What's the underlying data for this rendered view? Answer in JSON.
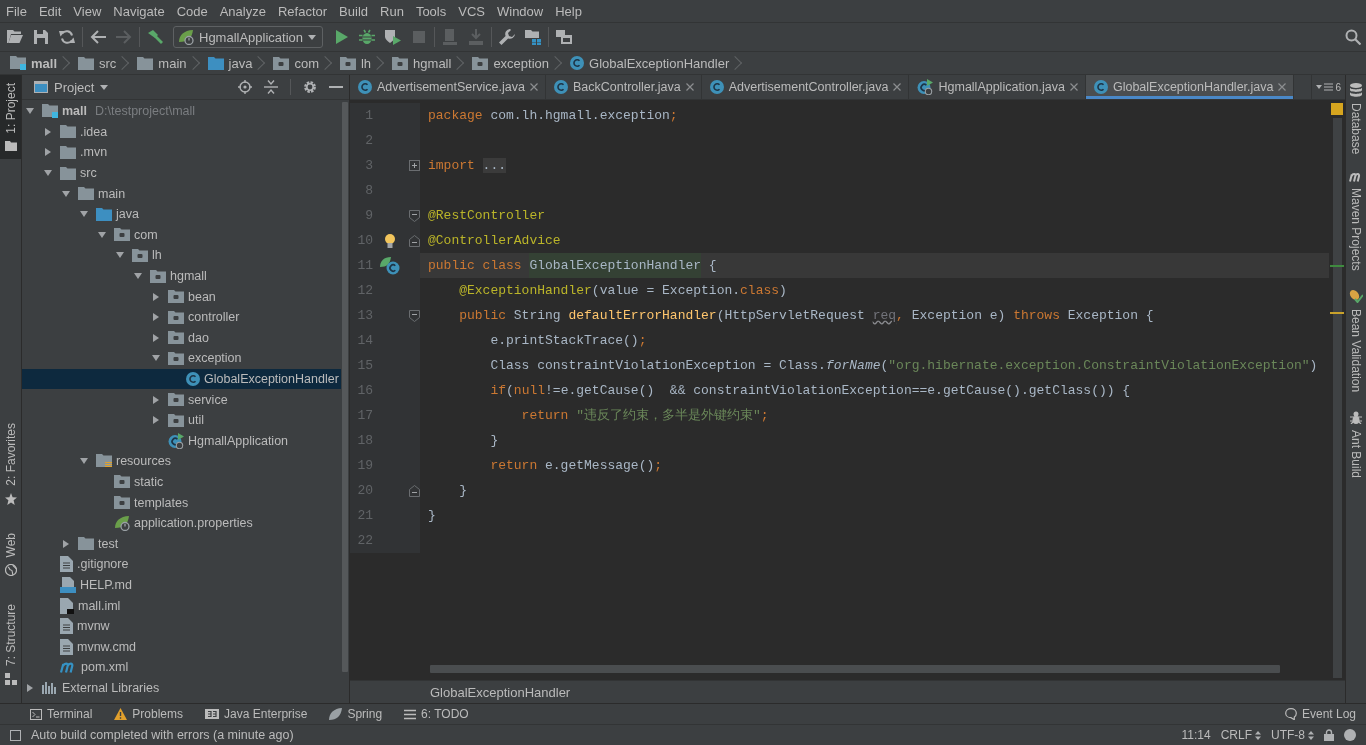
{
  "menu_bar": {
    "items": [
      "File",
      "Edit",
      "View",
      "Navigate",
      "Code",
      "Analyze",
      "Refactor",
      "Build",
      "Run",
      "Tools",
      "VCS",
      "Window",
      "Help"
    ]
  },
  "toolbar": {
    "groups": [
      {
        "items": [
          {
            "kind": "open",
            "disabled": false
          },
          {
            "kind": "save",
            "disabled": false
          },
          {
            "kind": "sync",
            "disabled": false
          }
        ]
      },
      {
        "items": [
          {
            "kind": "back",
            "disabled": false
          },
          {
            "kind": "forward",
            "disabled": true
          }
        ]
      },
      {
        "items": [
          {
            "kind": "build",
            "disabled": false
          },
          {
            "kind": "run_config",
            "label": "HgmallApplication",
            "disabled": false
          },
          {
            "kind": "run",
            "disabled": false
          },
          {
            "kind": "debug",
            "disabled": false
          },
          {
            "kind": "coverage",
            "disabled": false
          },
          {
            "kind": "stop",
            "disabled": true
          }
        ]
      },
      {
        "items": [
          {
            "kind": "device",
            "disabled": true
          },
          {
            "kind": "deploy",
            "disabled": true
          }
        ]
      },
      {
        "items": [
          {
            "kind": "settings",
            "disabled": false
          },
          {
            "kind": "project_structure",
            "disabled": false
          }
        ]
      },
      {
        "items": [
          {
            "kind": "windows",
            "disabled": false
          }
        ]
      }
    ]
  },
  "breadcrumbs": [
    {
      "label": "mall",
      "kind": "module"
    },
    {
      "label": "src",
      "kind": "folder"
    },
    {
      "label": "main",
      "kind": "folder"
    },
    {
      "label": "java",
      "kind": "source_folder"
    },
    {
      "label": "com",
      "kind": "package"
    },
    {
      "label": "lh",
      "kind": "package"
    },
    {
      "label": "hgmall",
      "kind": "package"
    },
    {
      "label": "exception",
      "kind": "package"
    },
    {
      "label": "GlobalExceptionHandler",
      "kind": "class"
    }
  ],
  "left_stripe": {
    "top": [
      {
        "label": "1: Project",
        "kind": "project",
        "selected": true
      }
    ],
    "bottom": [
      {
        "label": "2: Favorites",
        "kind": "favorites",
        "selected": false
      },
      {
        "label": "Web",
        "kind": "web",
        "selected": false
      },
      {
        "label": "7: Structure",
        "kind": "structure",
        "selected": false
      }
    ]
  },
  "project_panel": {
    "title": "Project",
    "tree": [
      {
        "label": "mall",
        "path": "D:\\testproject\\mall",
        "kind": "module",
        "expanded": true,
        "selected": false,
        "children": [
          {
            "label": ".idea",
            "kind": "folder",
            "expanded": false,
            "selected": false
          },
          {
            "label": ".mvn",
            "kind": "folder",
            "expanded": false,
            "selected": false
          },
          {
            "label": "src",
            "kind": "folder",
            "expanded": true,
            "selected": false,
            "children": [
              {
                "label": "main",
                "kind": "folder",
                "expanded": true,
                "selected": false,
                "children": [
                  {
                    "label": "java",
                    "kind": "source_folder",
                    "expanded": true,
                    "selected": false,
                    "children": [
                      {
                        "label": "com",
                        "kind": "package",
                        "expanded": true,
                        "selected": false,
                        "children": [
                          {
                            "label": "lh",
                            "kind": "package",
                            "expanded": true,
                            "selected": false,
                            "children": [
                              {
                                "label": "hgmall",
                                "kind": "package",
                                "expanded": true,
                                "selected": false,
                                "children": [
                                  {
                                    "label": "bean",
                                    "kind": "package",
                                    "expanded": false,
                                    "selected": false
                                  },
                                  {
                                    "label": "controller",
                                    "kind": "package",
                                    "expanded": false,
                                    "selected": false
                                  },
                                  {
                                    "label": "dao",
                                    "kind": "package",
                                    "expanded": false,
                                    "selected": false
                                  },
                                  {
                                    "label": "exception",
                                    "kind": "package",
                                    "expanded": true,
                                    "selected": false,
                                    "children": [
                                      {
                                        "label": "GlobalExceptionHandler",
                                        "kind": "class",
                                        "selected": true
                                      }
                                    ]
                                  },
                                  {
                                    "label": "service",
                                    "kind": "package",
                                    "expanded": false,
                                    "selected": false
                                  },
                                  {
                                    "label": "util",
                                    "kind": "package",
                                    "expanded": false,
                                    "selected": false
                                  },
                                  {
                                    "label": "HgmallApplication",
                                    "kind": "spring_class",
                                    "selected": false
                                  }
                                ]
                              }
                            ]
                          }
                        ]
                      }
                    ]
                  },
                  {
                    "label": "resources",
                    "kind": "resources",
                    "expanded": true,
                    "selected": false,
                    "children": [
                      {
                        "label": "static",
                        "kind": "package",
                        "selected": false
                      },
                      {
                        "label": "templates",
                        "kind": "package",
                        "selected": false
                      },
                      {
                        "label": "application.properties",
                        "kind": "spring_config",
                        "selected": false
                      }
                    ]
                  }
                ]
              },
              {
                "label": "test",
                "kind": "folder",
                "expanded": false,
                "selected": false
              }
            ]
          },
          {
            "label": ".gitignore",
            "kind": "file",
            "selected": false
          },
          {
            "label": "HELP.md",
            "kind": "markdown",
            "selected": false
          },
          {
            "label": "mall.iml",
            "kind": "module_file",
            "selected": false
          },
          {
            "label": "mvnw",
            "kind": "file",
            "selected": false
          },
          {
            "label": "mvnw.cmd",
            "kind": "file",
            "selected": false
          },
          {
            "label": "pom.xml",
            "kind": "maven",
            "selected": false
          }
        ]
      },
      {
        "label": "External Libraries",
        "kind": "libraries",
        "expanded": false,
        "selected": false
      }
    ]
  },
  "editor": {
    "tabs": [
      {
        "label": "AdvertisementService.java",
        "kind": "class",
        "selected": false
      },
      {
        "label": "BackController.java",
        "kind": "class",
        "selected": false
      },
      {
        "label": "AdvertisementController.java",
        "kind": "class",
        "selected": false
      },
      {
        "label": "HgmallApplication.java",
        "kind": "spring_class",
        "selected": false
      },
      {
        "label": "GlobalExceptionHandler.java",
        "kind": "class",
        "selected": true
      }
    ],
    "tab_overflow_count": "6",
    "lines": [
      {
        "number": "1",
        "current": false,
        "tokens": [
          {
            "text": "package",
            "kind": "keyword"
          },
          {
            "text": " com.lh.hgmall.exception",
            "kind": "plain"
          },
          {
            "text": ";",
            "kind": "keyword"
          }
        ]
      },
      {
        "number": "2",
        "current": false
      },
      {
        "number": "3",
        "current": false,
        "fold": {
          "kind": "collapsed"
        },
        "tokens": [
          {
            "text": "import ",
            "kind": "keyword"
          },
          {
            "text": "...",
            "kind": "folded"
          }
        ]
      },
      {
        "number": "8",
        "current": false
      },
      {
        "number": "9",
        "current": false,
        "fold": {
          "kind": "start"
        },
        "tokens": [
          {
            "text": "@RestController",
            "kind": "annotation"
          }
        ]
      },
      {
        "number": "10",
        "current": false,
        "fold": {
          "kind": "end"
        },
        "marker": {
          "kind": "intention"
        },
        "tokens": [
          {
            "text": "@ControllerAdvice",
            "kind": "annotation"
          }
        ]
      },
      {
        "number": "11",
        "current": true,
        "marker": {
          "kind": "bean"
        },
        "tokens": [
          {
            "text": "public class ",
            "kind": "keyword"
          },
          {
            "text": "GlobalExceptionHandler",
            "kind": "highlighted"
          },
          {
            "text": " {",
            "kind": "plain"
          }
        ]
      },
      {
        "number": "12",
        "current": false,
        "tokens": [
          {
            "text": "    @ExceptionHandler",
            "kind": "annotation"
          },
          {
            "text": "(value = Exception.",
            "kind": "plain"
          },
          {
            "text": "class",
            "kind": "keyword"
          },
          {
            "text": ")",
            "kind": "plain"
          }
        ]
      },
      {
        "number": "13",
        "current": false,
        "fold": {
          "kind": "start"
        },
        "tokens": [
          {
            "text": "    public",
            "kind": "keyword"
          },
          {
            "text": " String ",
            "kind": "plain"
          },
          {
            "text": "defaultErrorHandler",
            "kind": "method"
          },
          {
            "text": "(HttpServletRequest ",
            "kind": "plain"
          },
          {
            "text": "req",
            "kind": "unused"
          },
          {
            "text": ",",
            "kind": "keyword"
          },
          {
            "text": " Exception e) ",
            "kind": "plain"
          },
          {
            "text": "throws",
            "kind": "keyword"
          },
          {
            "text": " Exception {",
            "kind": "plain"
          }
        ]
      },
      {
        "number": "14",
        "current": false,
        "tokens": [
          {
            "text": "        e.printStackTrace()",
            "kind": "plain"
          },
          {
            "text": ";",
            "kind": "keyword"
          }
        ]
      },
      {
        "number": "15",
        "current": false,
        "tokens": [
          {
            "text": "        Class constraintViolationException = Class.",
            "kind": "plain"
          },
          {
            "text": "forName",
            "kind": "static"
          },
          {
            "text": "(",
            "kind": "plain"
          },
          {
            "text": "\"org.hibernate.exception.ConstraintViolationException\"",
            "kind": "string"
          },
          {
            "text": ")",
            "kind": "plain"
          }
        ]
      },
      {
        "number": "16",
        "current": false,
        "tokens": [
          {
            "text": "        if",
            "kind": "keyword"
          },
          {
            "text": "(",
            "kind": "plain"
          },
          {
            "text": "null",
            "kind": "keyword"
          },
          {
            "text": "!=e.getCause()  && constraintViolationException==e.getCause().getClass()) {",
            "kind": "plain"
          }
        ]
      },
      {
        "number": "17",
        "current": false,
        "tokens": [
          {
            "text": "            return ",
            "kind": "keyword"
          },
          {
            "text": "\"违反了约束，多半是外键约束\"",
            "kind": "string"
          },
          {
            "text": ";",
            "kind": "keyword"
          }
        ]
      },
      {
        "number": "18",
        "current": false,
        "tokens": [
          {
            "text": "        }",
            "kind": "plain"
          }
        ]
      },
      {
        "number": "19",
        "current": false,
        "tokens": [
          {
            "text": "        return",
            "kind": "keyword"
          },
          {
            "text": " e.getMessage()",
            "kind": "plain"
          },
          {
            "text": ";",
            "kind": "keyword"
          }
        ]
      },
      {
        "number": "20",
        "current": false,
        "fold": {
          "kind": "end"
        },
        "tokens": [
          {
            "text": "    }",
            "kind": "plain"
          }
        ]
      },
      {
        "number": "21",
        "current": false,
        "tokens": [
          {
            "text": "}",
            "kind": "plain"
          }
        ]
      },
      {
        "number": "22",
        "current": false
      }
    ],
    "breadcrumb": "GlobalExceptionHandler"
  },
  "right_stripe": [
    {
      "label": "Database",
      "kind": "database"
    },
    {
      "label": "Maven Projects",
      "kind": "maven"
    },
    {
      "label": "Bean Validation",
      "kind": "bean"
    },
    {
      "label": "Ant Build",
      "kind": "ant"
    }
  ],
  "bottom_tools": {
    "tools": [
      {
        "label": "Terminal",
        "kind": "terminal"
      },
      {
        "label": "Problems",
        "kind": "problems"
      },
      {
        "label": "Java Enterprise",
        "kind": "enterprise"
      },
      {
        "label": "Spring",
        "kind": "spring"
      },
      {
        "label": "6: TODO",
        "kind": "todo"
      }
    ],
    "event_log": "Event Log"
  },
  "status_bar": {
    "message": "Auto build completed with errors (a minute ago)",
    "position": "11:14",
    "line_separator": "CRLF",
    "encoding": "UTF-8"
  }
}
